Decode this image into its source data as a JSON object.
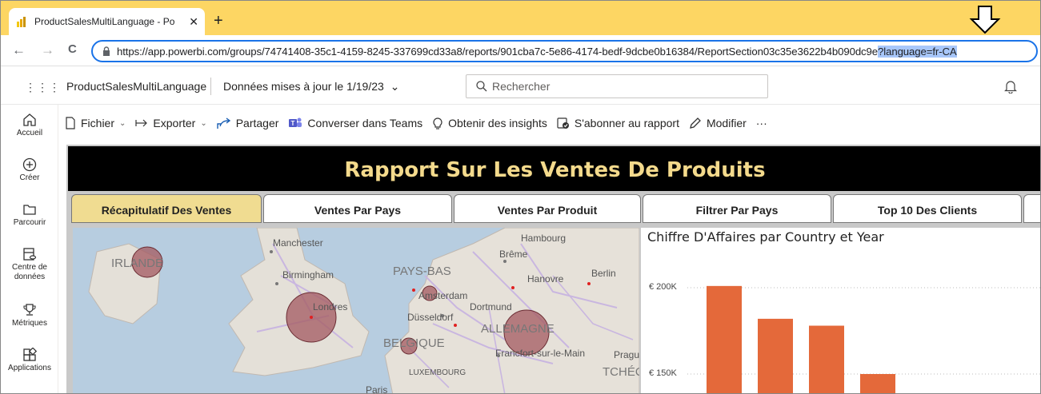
{
  "browser": {
    "tab_title": "ProductSalesMultiLanguage - Po",
    "tab_close": "✕",
    "new_tab": "+",
    "url_main": "https://app.powerbi.com/groups/74741408-35c1-4159-8245-337699cd33a8/reports/901cba7c-5e86-4174-bedf-9dcbe0b16384/ReportSection03c35e3622b4b090dc9e",
    "url_selected": "?language=fr-CA",
    "back": "←",
    "forward": "→",
    "reload": "C"
  },
  "header": {
    "waffle": "⋮⋮⋮",
    "report_name": "ProductSalesMultiLanguage",
    "updated": "Données mises à jour le 1/19/23",
    "updated_chevron": "⌄",
    "search_placeholder": "Rechercher"
  },
  "leftnav": [
    {
      "label": "Accueil",
      "icon": "home-icon"
    },
    {
      "label": "Créer",
      "icon": "create-icon"
    },
    {
      "label": "Parcourir",
      "icon": "folder-icon"
    },
    {
      "label": "Centre de données",
      "icon": "datahub-icon"
    },
    {
      "label": "Métriques",
      "icon": "trophy-icon"
    },
    {
      "label": "Applications",
      "icon": "apps-icon"
    }
  ],
  "actionbar": {
    "file": "Fichier",
    "export": "Exporter",
    "share": "Partager",
    "teams": "Converser dans Teams",
    "insights": "Obtenir des insights",
    "subscribe": "S'abonner au rapport",
    "edit": "Modifier",
    "more": "···"
  },
  "report": {
    "title": "Rapport Sur Les Ventes De Produits",
    "tabs": [
      "Récapitulatif Des Ventes",
      "Ventes Par Pays",
      "Ventes Par Produit",
      "Filtrer Par Pays",
      "Top 10 Des Clients"
    ],
    "active_tab": 0,
    "map_labels": {
      "manchester": "Manchester",
      "irlande": "IRLANDE",
      "birmingham": "Birmingham",
      "londres": "Londres",
      "paysbas": "PAYS-BAS",
      "hambourg": "Hambourg",
      "breme": "Brême",
      "hanovre": "Hanovre",
      "berlin": "Berlin",
      "amsterdam": "Amsterdam",
      "dortmund": "Dortmund",
      "dusseldorf": "Düsseldorf",
      "allemagne": "ALLEMAGNE",
      "belgique": "BELGIQUE",
      "francfort": "Francfort-sur-le-Main",
      "prague": "Pragu",
      "luxembourg": "LUXEMBOURG",
      "tcheq": "TCHÉQ",
      "paris": "Paris"
    }
  },
  "chart_data": {
    "type": "bar",
    "title": "Chiffre D'Affaires par Country et Year",
    "ytick_labels": [
      "€ 200K",
      "€ 150K"
    ],
    "yticks": [
      200000,
      150000
    ],
    "values": [
      201000,
      182000,
      178000,
      150000
    ],
    "color": "#e4693a"
  }
}
